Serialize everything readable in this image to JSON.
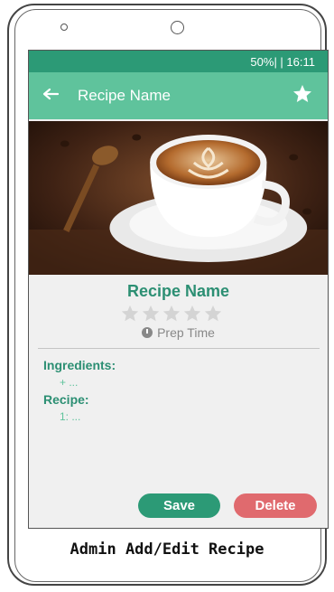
{
  "status_bar": {
    "text": "50%| | 16:11"
  },
  "app_bar": {
    "title": "Recipe Name",
    "back_icon": "back-arrow-icon",
    "favorite_icon": "star-icon"
  },
  "hero_image": {
    "description_icon": "coffee-cup-image"
  },
  "recipe": {
    "name": "Recipe Name",
    "rating_stars": 5,
    "rating_value": 0,
    "prep_time_label": "Prep Time"
  },
  "ingredients": {
    "label": "Ingredients:",
    "placeholder": "+ ..."
  },
  "steps": {
    "label": "Recipe:",
    "placeholder": "1: ..."
  },
  "actions": {
    "save_label": "Save",
    "delete_label": "Delete"
  },
  "caption": "Admin Add/Edit Recipe",
  "colors": {
    "status_bar": "#2c9a76",
    "app_bar": "#5fc39c",
    "accent_text": "#2c8f73",
    "save": "#2c9a76",
    "delete": "#e06a6e"
  }
}
